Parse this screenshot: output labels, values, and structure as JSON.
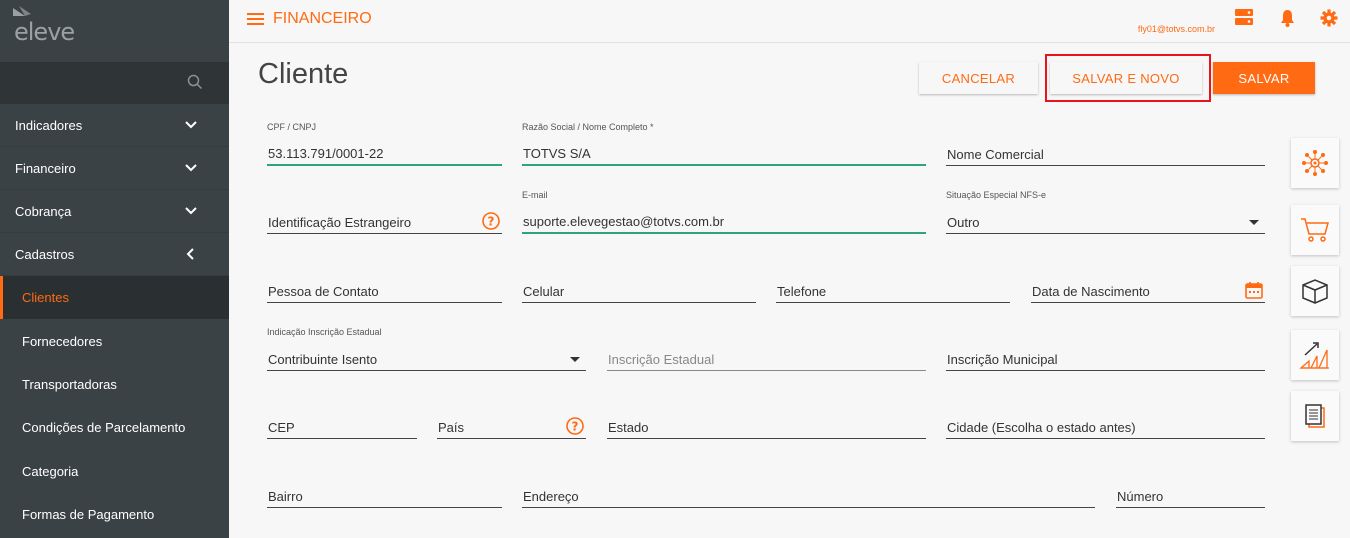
{
  "app": {
    "logo_text": "eleve",
    "module": "FINANCEIRO",
    "user_email": "fly01@totvs.com.br"
  },
  "sidebar": {
    "search_placeholder": "",
    "items": [
      {
        "label": "Indicadores"
      },
      {
        "label": "Financeiro"
      },
      {
        "label": "Cobrança"
      },
      {
        "label": "Cadastros"
      }
    ],
    "subitems": [
      {
        "label": "Clientes"
      },
      {
        "label": "Fornecedores"
      },
      {
        "label": "Transportadoras"
      },
      {
        "label": "Condições de Parcelamento"
      },
      {
        "label": "Categoria"
      },
      {
        "label": "Formas de Pagamento"
      }
    ]
  },
  "page": {
    "title": "Cliente",
    "buttons": {
      "cancel": "CANCELAR",
      "save_new": "SALVAR E NOVO",
      "save": "SALVAR"
    }
  },
  "form": {
    "cpf": {
      "label": "CPF / CNPJ",
      "value": "53.113.791/0001-22"
    },
    "razao": {
      "label": "Razão Social / Nome Completo *",
      "value": "TOTVS S/A"
    },
    "nome_comercial": {
      "placeholder": "Nome Comercial"
    },
    "ident_estrangeiro": {
      "placeholder": "Identificação Estrangeiro"
    },
    "email": {
      "label": "E-mail",
      "value": "suporte.elevegestao@totvs.com.br"
    },
    "situacao": {
      "label": "Situação Especial NFS-e",
      "value": "Outro"
    },
    "pessoa_contato": {
      "placeholder": "Pessoa de Contato"
    },
    "celular": {
      "placeholder": "Celular"
    },
    "telefone": {
      "placeholder": "Telefone"
    },
    "nascimento": {
      "placeholder": "Data de Nascimento"
    },
    "indicacao_ie": {
      "label": "Indicação Inscrição Estadual",
      "value": "Contribuinte Isento"
    },
    "inscricao_estadual": {
      "placeholder": "Inscrição Estadual"
    },
    "inscricao_municipal": {
      "placeholder": "Inscrição Municipal"
    },
    "cep": {
      "placeholder": "CEP"
    },
    "pais": {
      "placeholder": "País"
    },
    "estado": {
      "placeholder": "Estado"
    },
    "cidade": {
      "placeholder": "Cidade (Escolha o estado antes)"
    },
    "bairro": {
      "placeholder": "Bairro"
    },
    "endereco": {
      "placeholder": "Endereço"
    },
    "numero": {
      "placeholder": "Número"
    }
  },
  "colors": {
    "accent": "#ff6a13",
    "sidebar": "#3b4245",
    "focus": "#2fa37a",
    "highlight": "#e8141c"
  },
  "side_cards": [
    "network-icon",
    "cart-icon",
    "box-icon",
    "chart-growth-icon",
    "documents-icon"
  ]
}
